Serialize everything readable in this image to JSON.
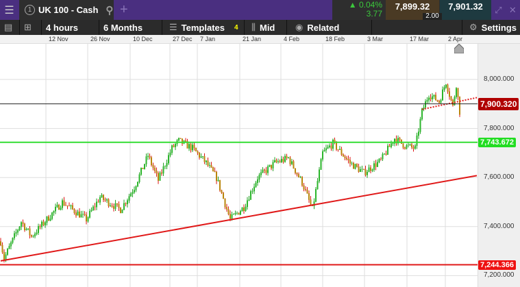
{
  "topbar": {
    "menu_icon": "hamburger-icon",
    "tab_number": "1",
    "tab_title": "UK 100 - Cash",
    "add_tab": "+",
    "change_pct": "▲ 0.04%",
    "change_abs": "3.77",
    "bid": "7,899.32",
    "ask": "7,901.32",
    "spread": "2.00"
  },
  "toolbar": {
    "interval": "4 hours",
    "range": "6 Months",
    "templates": "Templates",
    "badge": "4",
    "price_type": "Mid",
    "related": "Related",
    "settings": "Settings"
  },
  "date_axis": [
    "12 Nov",
    "26 Nov",
    "10 Dec",
    "27 Dec",
    "7 Jan",
    "21 Jan",
    "4 Feb",
    "18 Feb",
    "3 Mar",
    "17 Mar",
    "2 Apr"
  ],
  "price_axis": [
    "8,000.000",
    "7,800.000",
    "7,600.000",
    "7,400.000",
    "7,200.000"
  ],
  "chart_data": {
    "type": "candlestick",
    "instrument": "UK 100 - Cash",
    "ylim": [
      7180,
      8150
    ],
    "yticks": [
      8000,
      7800,
      7600,
      7400,
      7200
    ],
    "path_keypoints": [
      [
        0,
        7340
      ],
      [
        2,
        7270
      ],
      [
        12,
        7420
      ],
      [
        18,
        7360
      ],
      [
        36,
        7500
      ],
      [
        50,
        7430
      ],
      [
        58,
        7520
      ],
      [
        70,
        7470
      ],
      [
        78,
        7560
      ],
      [
        86,
        7690
      ],
      [
        92,
        7590
      ],
      [
        100,
        7720
      ],
      [
        104,
        7750
      ],
      [
        112,
        7720
      ],
      [
        120,
        7660
      ],
      [
        126,
        7600
      ],
      [
        134,
        7430
      ],
      [
        142,
        7480
      ],
      [
        150,
        7600
      ],
      [
        160,
        7660
      ],
      [
        168,
        7680
      ],
      [
        176,
        7580
      ],
      [
        182,
        7470
      ],
      [
        188,
        7700
      ],
      [
        194,
        7740
      ],
      [
        204,
        7660
      ],
      [
        212,
        7620
      ],
      [
        222,
        7670
      ],
      [
        230,
        7760
      ],
      [
        236,
        7730
      ],
      [
        242,
        7720
      ],
      [
        246,
        7870
      ],
      [
        250,
        7940
      ],
      [
        256,
        7910
      ],
      [
        260,
        7990
      ],
      [
        264,
        7890
      ],
      [
        266,
        7980
      ],
      [
        268,
        7870
      ]
    ],
    "horizontal_lines": [
      {
        "label": "7,900.320",
        "price": 7900.32,
        "color": "#b00000"
      },
      {
        "label": "7,743.672",
        "price": 7743.672,
        "color": "#22dd22"
      },
      {
        "label": "7,244.366",
        "price": 7244.366,
        "color": "#ee1111"
      }
    ],
    "trendline": {
      "from": [
        0,
        7260
      ],
      "to": [
        278,
        7608
      ]
    },
    "dotted_trend": {
      "from": [
        246,
        7878
      ],
      "to": [
        278,
        7926
      ]
    }
  }
}
